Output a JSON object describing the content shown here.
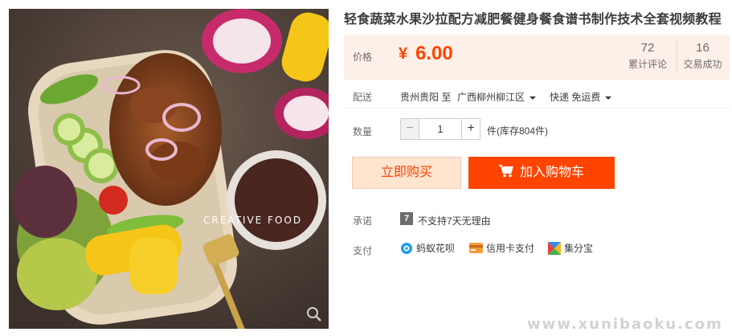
{
  "product": {
    "title": "轻食蔬菜水果沙拉配方减肥餐健身餐食谱书制作技术全套视频教程",
    "image_overlay_text": "CREATIVE FOOD"
  },
  "price": {
    "label": "价格",
    "symbol": "¥",
    "value": "6.00"
  },
  "stats": [
    {
      "count": "72",
      "label": "累计评论"
    },
    {
      "count": "16",
      "label": "交易成功"
    }
  ],
  "delivery": {
    "label": "配送",
    "from": "贵州贵阳 至",
    "to": "广西柳州柳江区",
    "method": "快递 免运费"
  },
  "quantity": {
    "label": "数量",
    "minus": "−",
    "value": "1",
    "plus": "+",
    "stock": "件(库存804件)"
  },
  "actions": {
    "buy_now": "立即购买",
    "add_to_cart": "加入购物车"
  },
  "promise": {
    "label": "承诺",
    "badge": "7",
    "text": "不支持7天无理由"
  },
  "payment": {
    "label": "支付",
    "methods": [
      {
        "name": "蚂蚁花呗",
        "icon": "huabei-icon"
      },
      {
        "name": "信用卡支付",
        "icon": "credit-card-icon"
      },
      {
        "name": "集分宝",
        "icon": "jifenbao-icon"
      }
    ]
  },
  "watermark": "www.xunibaoku.com",
  "colors": {
    "accent": "#ff4400",
    "price_bg": "#fdf0e8",
    "buy_now_bg": "#ffe4d0"
  }
}
